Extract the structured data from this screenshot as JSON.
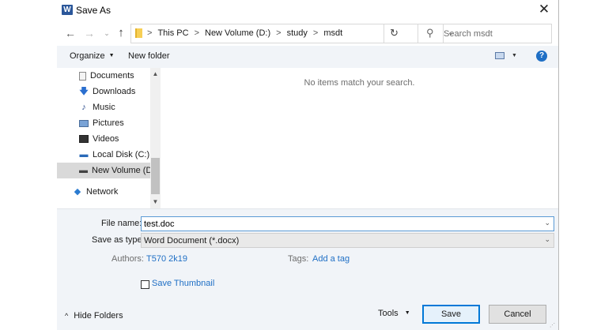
{
  "window": {
    "title": "Save As",
    "app_icon": "W",
    "close_glyph": "✕"
  },
  "nav": {
    "back": "←",
    "forward": "→",
    "recent": "⌄",
    "up": "↑"
  },
  "address": {
    "crumbs": [
      "This PC",
      "New Volume (D:)",
      "study",
      "msdt"
    ],
    "separator": ">",
    "chevron": "⌄",
    "refresh": "↻"
  },
  "search": {
    "placeholder": "Search msdt",
    "icon": "⚲"
  },
  "toolbar": {
    "organize": "Organize",
    "caret": "▼",
    "new_folder": "New folder",
    "help": "?"
  },
  "sidebar": {
    "items": [
      {
        "label": "Documents",
        "icon": "documents-icon"
      },
      {
        "label": "Downloads",
        "icon": "downloads-icon",
        "glyph": "🡇"
      },
      {
        "label": "Music",
        "icon": "music-icon",
        "glyph": "♪"
      },
      {
        "label": "Pictures",
        "icon": "pictures-icon"
      },
      {
        "label": "Videos",
        "icon": "videos-icon"
      },
      {
        "label": "Local Disk (C:)",
        "icon": "local-disk-icon",
        "glyph": "▬"
      },
      {
        "label": "New Volume (D:)",
        "icon": "drive-icon",
        "glyph": "▬",
        "selected": true
      },
      {
        "label": "Network",
        "icon": "network-icon",
        "glyph": "◆"
      }
    ],
    "scroll_up": "▲",
    "scroll_down": "▼"
  },
  "content": {
    "empty_message": "No items match your search."
  },
  "form": {
    "file_name_label": "File name:",
    "file_name_value": "test.doc",
    "save_type_label": "Save as type:",
    "save_type_value": "Word Document (*.docx)",
    "authors_label": "Authors:",
    "authors_value": "T570 2k19",
    "tags_label": "Tags:",
    "tags_value": "Add a tag",
    "thumbnail_label": "Save Thumbnail",
    "thumbnail_checked": false,
    "dropdown_chevron": "⌄"
  },
  "footer": {
    "hide_folders": "Hide Folders",
    "hide_caret": "^",
    "tools": "Tools",
    "tools_caret": "▼",
    "save": "Save",
    "cancel": "Cancel",
    "grip": "⋰"
  },
  "colors": {
    "accent": "#1f6fc5",
    "toolbar_bg": "#f1f4f8",
    "focus_border": "#5b9bd5",
    "selected_bg": "#d9d9d9"
  }
}
